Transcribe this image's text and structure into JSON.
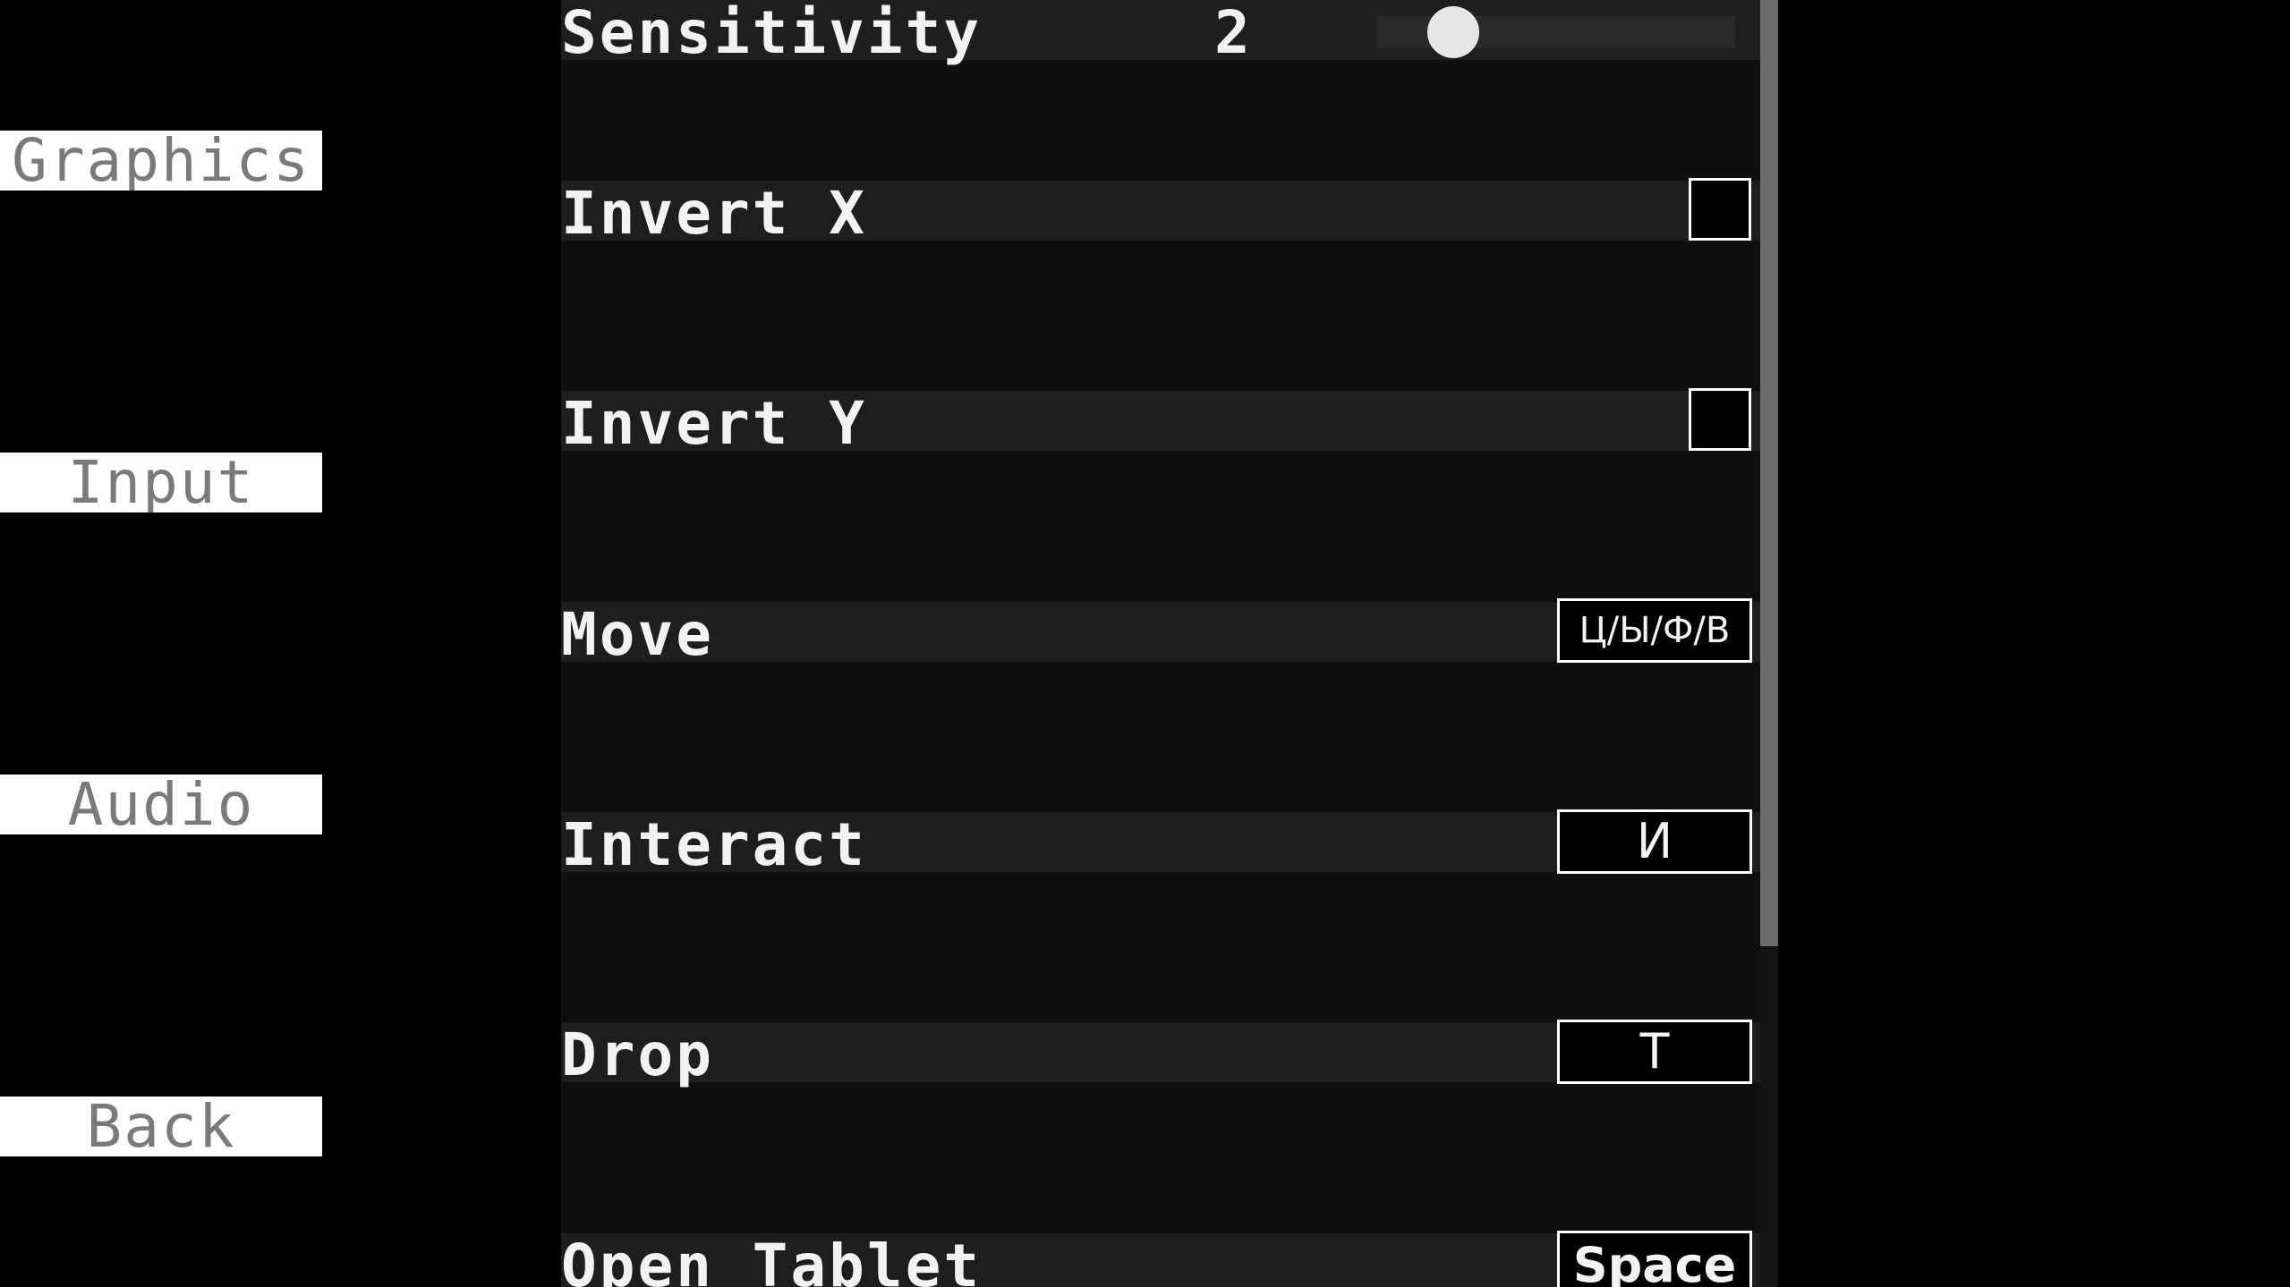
{
  "menu": {
    "graphics_label": "Graphics",
    "input_label": "Input",
    "audio_label": "Audio",
    "back_label": "Back"
  },
  "settings": {
    "sensitivity": {
      "label": "Sensitivity",
      "value_text": "2"
    },
    "invert_x": {
      "label": "Invert X",
      "checked": false
    },
    "invert_y": {
      "label": "Invert Y",
      "checked": false
    },
    "move": {
      "label": "Move",
      "key": "Ц/Ы/Ф/В"
    },
    "interact": {
      "label": "Interact",
      "key": "И"
    },
    "drop": {
      "label": "Drop",
      "key": "Т"
    },
    "open_tablet": {
      "label": "Open Tablet",
      "key": "Space"
    }
  },
  "colors": {
    "background": "#000000",
    "panel": "#0f0f0f",
    "row": "#1e1e1e",
    "menu_button_bg": "#ffffff",
    "menu_button_text": "#7a7a7a",
    "text": "#f2f2f2",
    "scrollbar_thumb": "#6a6a6a"
  }
}
